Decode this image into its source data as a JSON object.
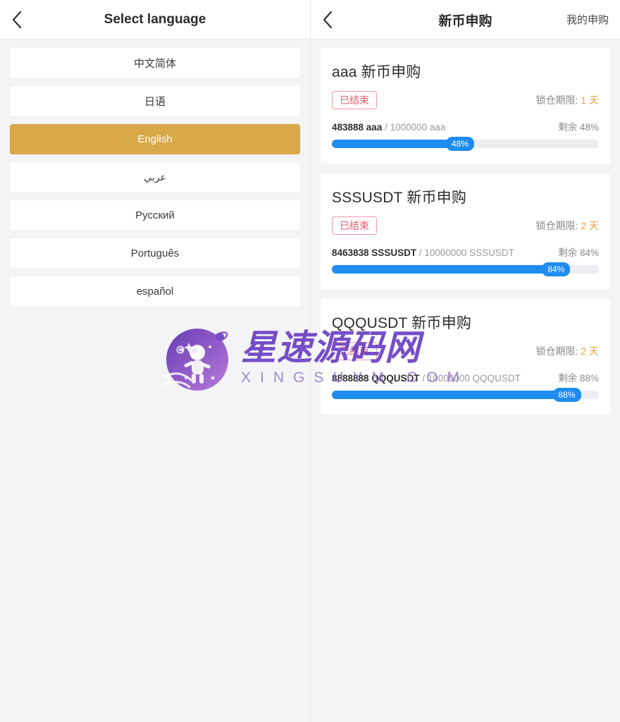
{
  "left_panel": {
    "navbar": {
      "back_icon": "chevron-left-icon",
      "title": "Select language"
    },
    "languages": [
      {
        "label": "中文简体",
        "selected": false,
        "rtl": false
      },
      {
        "label": "日语",
        "selected": false,
        "rtl": false
      },
      {
        "label": "English",
        "selected": true,
        "rtl": false
      },
      {
        "label": "عربي",
        "selected": false,
        "rtl": true
      },
      {
        "label": "Русский",
        "selected": false,
        "rtl": false
      },
      {
        "label": "Português",
        "selected": false,
        "rtl": false
      },
      {
        "label": "español",
        "selected": false,
        "rtl": false
      }
    ],
    "selected_color": "#d8a849"
  },
  "right_panel": {
    "navbar": {
      "back_icon": "chevron-left-icon",
      "title": "新币申购",
      "action_label": "我的申购"
    },
    "offerings": [
      {
        "title": "aaa 新币申购",
        "status": "已结束",
        "lock_label": "锁仓期限:",
        "lock_value": "1 天",
        "sold": "483888 aaa",
        "total": "/ 1000000 aaa",
        "remain": "剩余 48%",
        "percent_label": "48%",
        "percent": 48
      },
      {
        "title": "SSSUSDT 新币申购",
        "status": "已结束",
        "lock_label": "锁仓期限:",
        "lock_value": "2 天",
        "sold": "8463838 SSSUSDT",
        "total": "/ 10000000 SSSUSDT",
        "remain": "剩余 84%",
        "percent_label": "84%",
        "percent": 84
      },
      {
        "title": "QQQUSDT 新币申购",
        "status": "已结束",
        "lock_label": "锁仓期限:",
        "lock_value": "2 天",
        "sold": "8888888 QQQUSDT",
        "total": "/ 10000000 QQQUSDT",
        "remain": "剩余 88%",
        "percent_label": "88%",
        "percent": 88
      }
    ],
    "progress_color": "#1f8cf0",
    "status_color": "#e45c6a",
    "lock_color": "#e8a33d"
  },
  "watermark": {
    "name": "星速源码网",
    "domain": "XINGSUYM.COM",
    "color": "#6b3fc4"
  }
}
